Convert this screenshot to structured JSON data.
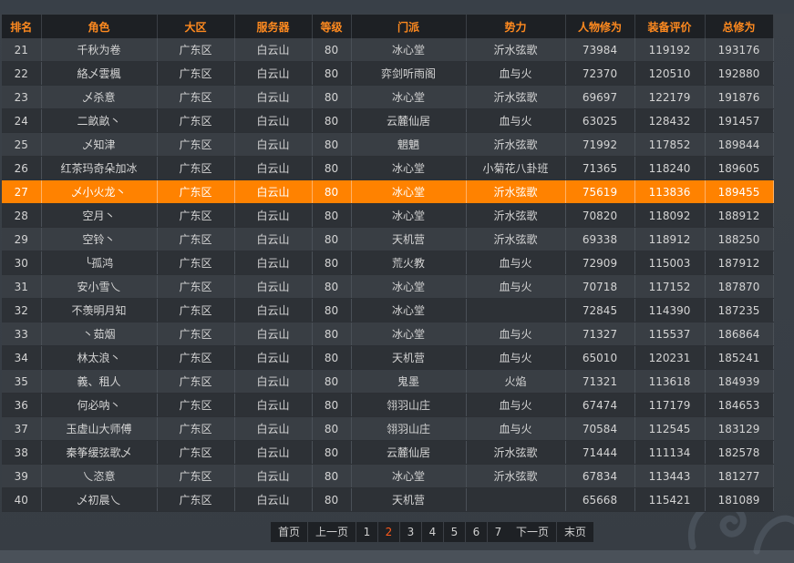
{
  "table": {
    "headers": [
      "排名",
      "角色",
      "大区",
      "服务器",
      "等级",
      "门派",
      "势力",
      "人物修为",
      "装备评价",
      "总修为"
    ],
    "highlight_rank": "27",
    "rows": [
      [
        "21",
        "千秋为卷",
        "广东区",
        "白云山",
        "80",
        "冰心堂",
        "沂水弦歌",
        "73984",
        "119192",
        "193176"
      ],
      [
        "22",
        "絡乄雲楓",
        "广东区",
        "白云山",
        "80",
        "弈剑听雨阁",
        "血与火",
        "72370",
        "120510",
        "192880"
      ],
      [
        "23",
        "乄杀意",
        "广东区",
        "白云山",
        "80",
        "冰心堂",
        "沂水弦歌",
        "69697",
        "122179",
        "191876"
      ],
      [
        "24",
        "二畝畝丶",
        "广东区",
        "白云山",
        "80",
        "云麓仙居",
        "血与火",
        "63025",
        "128432",
        "191457"
      ],
      [
        "25",
        "乄知津",
        "广东区",
        "白云山",
        "80",
        "魍魉",
        "沂水弦歌",
        "71992",
        "117852",
        "189844"
      ],
      [
        "26",
        "红茶玛奇朵加冰",
        "广东区",
        "白云山",
        "80",
        "冰心堂",
        "小菊花八卦班",
        "71365",
        "118240",
        "189605"
      ],
      [
        "27",
        "乄小火龙丶",
        "广东区",
        "白云山",
        "80",
        "冰心堂",
        "沂水弦歌",
        "75619",
        "113836",
        "189455"
      ],
      [
        "28",
        "空月丶",
        "广东区",
        "白云山",
        "80",
        "冰心堂",
        "沂水弦歌",
        "70820",
        "118092",
        "188912"
      ],
      [
        "29",
        "空铃丶",
        "广东区",
        "白云山",
        "80",
        "天机营",
        "沂水弦歌",
        "69338",
        "118912",
        "188250"
      ],
      [
        "30",
        "╰孤鸿",
        "广东区",
        "白云山",
        "80",
        "荒火教",
        "血与火",
        "72909",
        "115003",
        "187912"
      ],
      [
        "31",
        "安小雪乀",
        "广东区",
        "白云山",
        "80",
        "冰心堂",
        "血与火",
        "70718",
        "117152",
        "187870"
      ],
      [
        "32",
        "不羡明月知",
        "广东区",
        "白云山",
        "80",
        "冰心堂",
        "",
        "72845",
        "114390",
        "187235"
      ],
      [
        "33",
        "丶茹烟",
        "广东区",
        "白云山",
        "80",
        "冰心堂",
        "血与火",
        "71327",
        "115537",
        "186864"
      ],
      [
        "34",
        "林太浪丶",
        "广东区",
        "白云山",
        "80",
        "天机营",
        "血与火",
        "65010",
        "120231",
        "185241"
      ],
      [
        "35",
        "義、租人",
        "广东区",
        "白云山",
        "80",
        "鬼墨",
        "火焰",
        "71321",
        "113618",
        "184939"
      ],
      [
        "36",
        "何必呐丶",
        "广东区",
        "白云山",
        "80",
        "翎羽山庄",
        "血与火",
        "67474",
        "117179",
        "184653"
      ],
      [
        "37",
        "玉虚山大师傅",
        "广东区",
        "白云山",
        "80",
        "翎羽山庄",
        "血与火",
        "70584",
        "112545",
        "183129"
      ],
      [
        "38",
        "秦筝缓弦歌乄",
        "广东区",
        "白云山",
        "80",
        "云麓仙居",
        "沂水弦歌",
        "71444",
        "111134",
        "182578"
      ],
      [
        "39",
        "乀恣意",
        "广东区",
        "白云山",
        "80",
        "冰心堂",
        "沂水弦歌",
        "67834",
        "113443",
        "181277"
      ],
      [
        "40",
        "乄初晨乀",
        "广东区",
        "白云山",
        "80",
        "天机营",
        "",
        "65668",
        "115421",
        "181089"
      ]
    ]
  },
  "pager": {
    "first": "首页",
    "prev": "上一页",
    "pages": [
      "1",
      "2",
      "3",
      "4",
      "5",
      "6",
      "7"
    ],
    "current": "2",
    "next": "下一页",
    "last": "末页"
  }
}
